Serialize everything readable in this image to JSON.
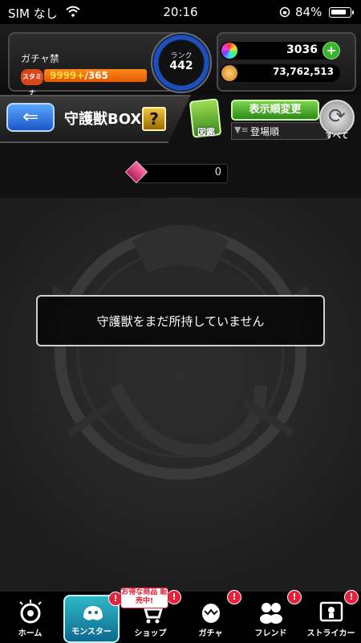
{
  "status_bar": {
    "carrier": "SIM なし",
    "time": "20:16",
    "battery_percent": "84%",
    "battery_level": 0.84
  },
  "header": {
    "gacha_label": "ガチャ禁",
    "stamina_icon_label": "スタミナ",
    "stamina_current": "9999+",
    "stamina_max": "/365",
    "rank_label": "ランク",
    "rank_value": "442",
    "orb_count": "3036",
    "orb_add_label": "+",
    "gold_count": "73,762,513"
  },
  "title_bar": {
    "back_label": "⇐",
    "title": "守護獣BOX",
    "help_label": "?",
    "zukan_label": "図鑑",
    "sort_button_label": "表示順変更",
    "sort_order_label": "登場順",
    "all_label": "すべて"
  },
  "count_bar": {
    "value": "0"
  },
  "main": {
    "message": "守護獣をまだ所持していません"
  },
  "nav": {
    "items": [
      {
        "label": "ホーム",
        "icon": "home-icon"
      },
      {
        "label": "モンスター",
        "icon": "monster-icon",
        "badge": "!"
      },
      {
        "label": "ショップ",
        "icon": "cart-icon",
        "badge": "!",
        "promo": "お得な商品 販売中!"
      },
      {
        "label": "ガチャ",
        "icon": "gacha-egg-icon",
        "badge": "!"
      },
      {
        "label": "フレンド",
        "icon": "friends-icon",
        "badge": "!"
      },
      {
        "label": "ストライカー",
        "icon": "striker-card-icon",
        "badge": "!"
      }
    ]
  },
  "colors": {
    "accent_blue": "#1b57c7",
    "accent_green": "#2d8a19",
    "stamina_orange": "#e45800",
    "badge_red": "#e8203a"
  }
}
